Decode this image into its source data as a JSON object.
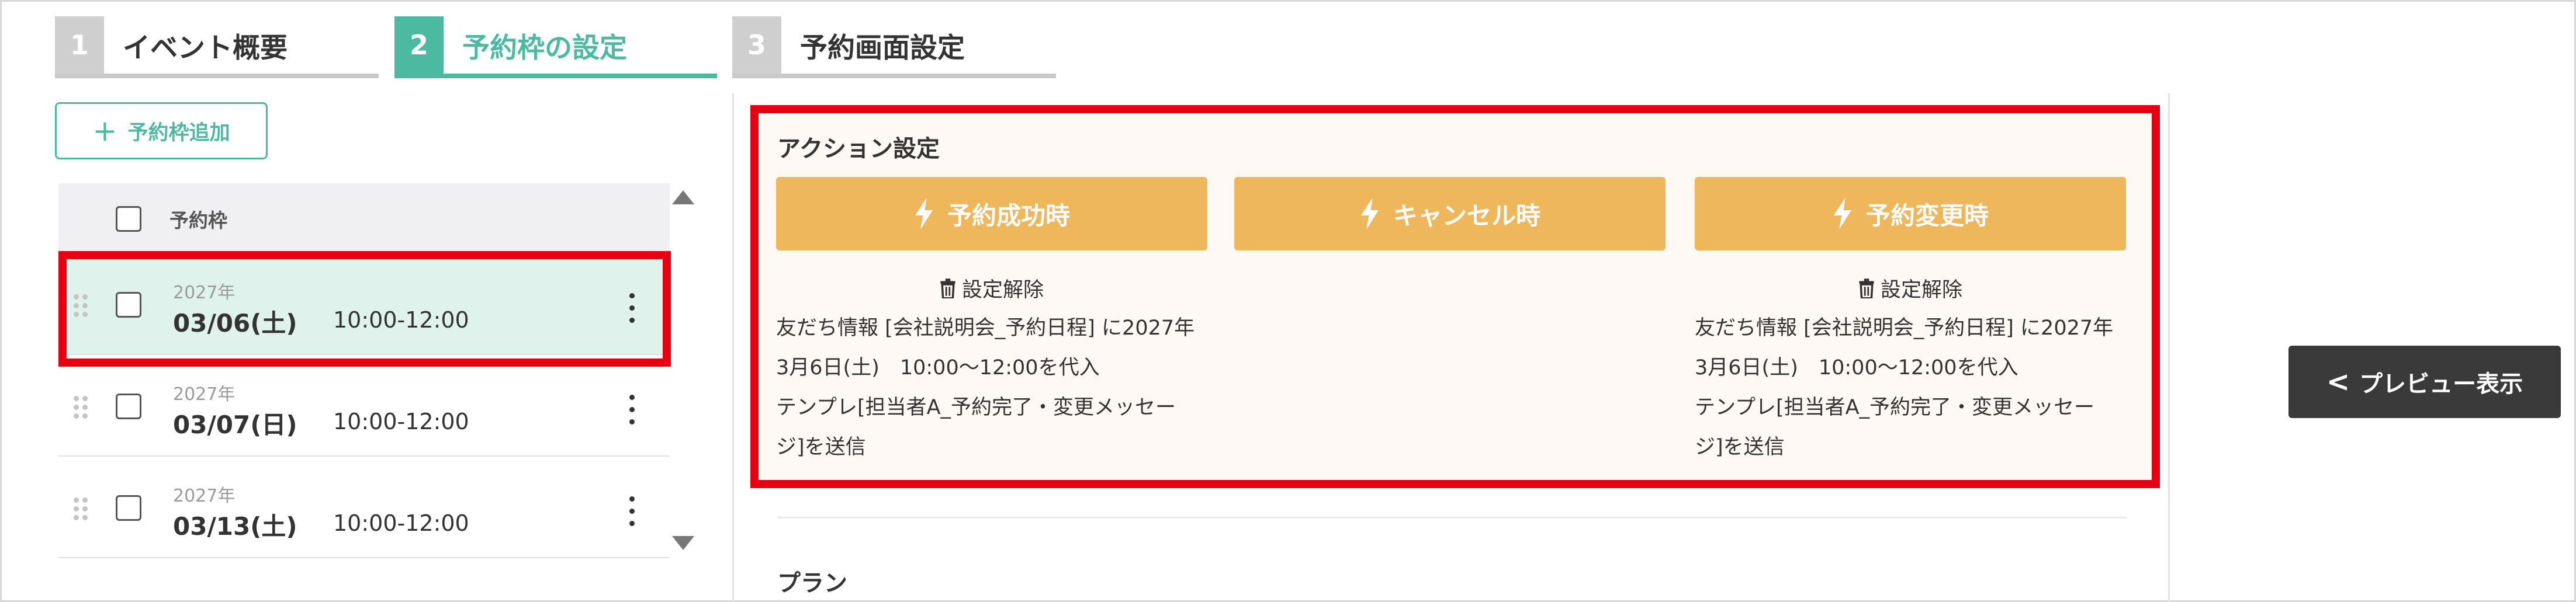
{
  "steps": [
    {
      "number": "1",
      "label": "イベント概要",
      "active": false
    },
    {
      "number": "2",
      "label": "予約枠の設定",
      "active": true
    },
    {
      "number": "3",
      "label": "予約画面設定",
      "active": false
    }
  ],
  "slots_panel": {
    "add_button_label": "予約枠追加",
    "header_label": "予約枠",
    "rows": [
      {
        "year": "2027年",
        "date": "03/06(土)",
        "time": "10:00-12:00",
        "selected": true
      },
      {
        "year": "2027年",
        "date": "03/07(日)",
        "time": "10:00-12:00",
        "selected": false
      },
      {
        "year": "2027年",
        "date": "03/13(土)",
        "time": "10:00-12:00",
        "selected": false
      }
    ]
  },
  "action_settings": {
    "title": "アクション設定",
    "buttons": [
      {
        "label": "予約成功時",
        "icon": "lightning-icon"
      },
      {
        "label": "キャンセル時",
        "icon": "lightning-icon"
      },
      {
        "label": "予約変更時",
        "icon": "lightning-icon"
      }
    ],
    "success": {
      "unset_label": "設定解除",
      "lines": [
        "友だち情報 [会社説明会_予約日程] に2027年",
        "3月6日(土)　10:00〜12:00を代入",
        "テンプレ[担当者A_予約完了・変更メッセー",
        "ジ]を送信"
      ]
    },
    "change": {
      "unset_label": "設定解除",
      "lines": [
        "友だち情報 [会社説明会_予約日程] に2027年",
        "3月6日(土)　10:00〜12:00を代入",
        "テンプレ[担当者A_予約完了・変更メッセー",
        "ジ]を送信"
      ]
    }
  },
  "plan_label": "プラン",
  "preview_button": {
    "chevron": "<",
    "label": "プレビュー表示"
  },
  "colors": {
    "accent_green": "#4cbaa0",
    "action_orange": "#efb75c",
    "highlight_red": "#e60012",
    "selected_row_bg": "#e0f2ec",
    "preview_bg": "#3a3a3a"
  }
}
